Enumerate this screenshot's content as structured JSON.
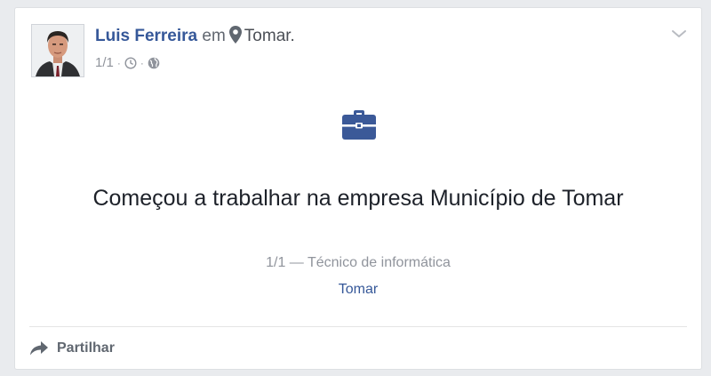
{
  "post": {
    "author_name": "Luis Ferreira",
    "connector": "em",
    "place": "Tomar.",
    "date": "1/1",
    "separator": "·",
    "headline": "Começou a trabalhar na empresa Município de Tomar",
    "subline": "1/1 — Técnico de informática",
    "subplace": "Tomar"
  },
  "actions": {
    "share_label": "Partilhar"
  },
  "icons": {
    "location": "map-pin-icon",
    "time": "clock-icon",
    "privacy": "globe-icon",
    "menu": "chevron-down-icon",
    "event": "briefcase-icon",
    "share": "share-arrow-icon"
  },
  "colors": {
    "link": "#365899",
    "muted": "#90949c",
    "text": "#1d2129",
    "briefcase": "#3b5998",
    "background": "#e9ebee"
  }
}
